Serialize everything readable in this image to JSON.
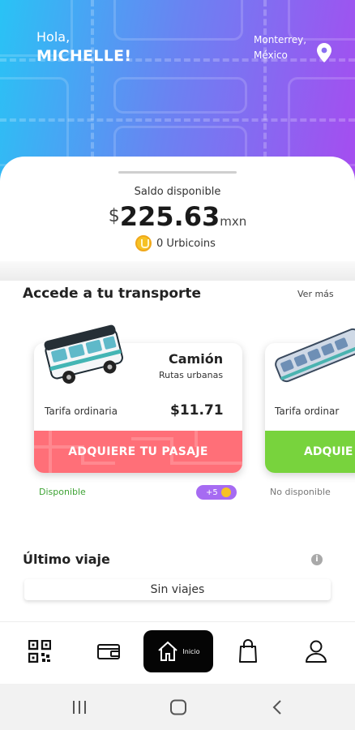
{
  "header": {
    "greeting": "Hola,",
    "user_name": "MICHELLE!",
    "city": "Monterrey,",
    "country": "México",
    "location_icon": "location-pin-icon",
    "gradient": [
      "#29c3f5",
      "#6a83f2",
      "#a64cf0"
    ]
  },
  "balance": {
    "label": "Saldo disponible",
    "currency_symbol": "$",
    "amount": "225.63",
    "unit": "mxn",
    "coins_text": "0 Urbicoins"
  },
  "transport": {
    "title": "Accede a tu transporte",
    "see_more": "Ver más",
    "cards": [
      {
        "name": "Camión",
        "subtitle": "Rutas urbanas",
        "fare_label": "Tarifa ordinaria",
        "fare_value": "$11.71",
        "cta": "ADQUIERE TU PASAJE",
        "status": "Disponible",
        "badge": "+5",
        "accent": "#ff6f78"
      },
      {
        "fare_label": "Tarifa ordinar",
        "cta": "ADQUIE",
        "status": "No disponible",
        "accent": "#78d33d"
      }
    ]
  },
  "last_trip": {
    "title": "Último viaje",
    "empty_text": "Sin viajes"
  },
  "nav": {
    "home_label": "Inicio",
    "items": [
      "qr-code-icon",
      "wallet-icon",
      "home-icon",
      "shopping-bag-icon",
      "profile-icon"
    ]
  }
}
